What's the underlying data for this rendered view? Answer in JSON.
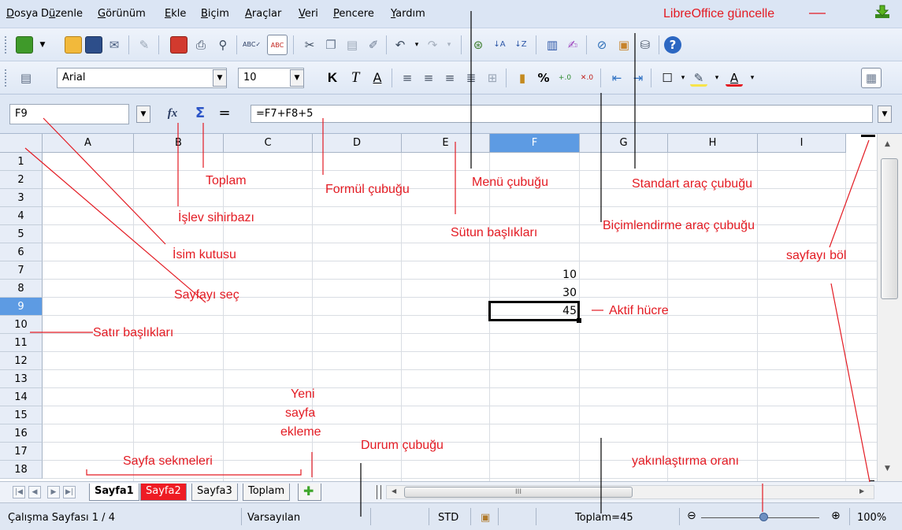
{
  "menubar": {
    "items": [
      {
        "ul": "D",
        "rest": "osya"
      },
      {
        "ul": "",
        "pre": "D",
        "ul2": "ü",
        "rest": "zenle"
      },
      {
        "ul": "G",
        "rest": "örünüm"
      },
      {
        "ul": "E",
        "rest": "kle"
      },
      {
        "ul": "B",
        "rest": "içim"
      },
      {
        "ul": "A",
        "rest": "raçlar"
      },
      {
        "ul": "V",
        "rest": "eri"
      },
      {
        "ul": "P",
        "rest": "encere"
      },
      {
        "ul": "Y",
        "rest": "ardım"
      }
    ],
    "update_text": "LibreOffice güncelle",
    "update_icon": "download-arrow-icon"
  },
  "formatting": {
    "font_name": "Arial",
    "font_size": "10",
    "bold": "K",
    "italic": "T",
    "underline": "A",
    "percent": "%"
  },
  "formula_bar": {
    "name_box_value": "F9",
    "formula_value": "=F7+F8+5",
    "wizard_glyph": "fx",
    "sum_glyph": "Σ",
    "equals_glyph": "="
  },
  "grid": {
    "columns": [
      "A",
      "B",
      "C",
      "D",
      "E",
      "F",
      "G",
      "H",
      "I"
    ],
    "active_column": "F",
    "rows": [
      "1",
      "2",
      "3",
      "4",
      "5",
      "6",
      "7",
      "8",
      "9",
      "10",
      "11",
      "12",
      "13",
      "14",
      "15",
      "16",
      "17",
      "18"
    ],
    "active_row": "9",
    "cells": {
      "F7": "10",
      "F8": "30",
      "F9": "45"
    }
  },
  "sheet_tabs": [
    "Sayfa1",
    "Sayfa2",
    "Sayfa3",
    "Toplam"
  ],
  "hscroll_thumb_label": "III",
  "statusbar": {
    "sheet_info": "Çalışma Sayfası 1 / 4",
    "page_style": "Varsayılan",
    "mode": "STD",
    "sum": "Toplam=45",
    "zoom_minus": "⊖",
    "zoom_plus": "⊕",
    "zoom": "100%"
  },
  "annotations": {
    "toplam": "Toplam",
    "formul_cubugu": "Formül çubuğu",
    "menu_cubugu": "Menü çubuğu",
    "standart_arac": "Standart araç çubuğu",
    "islev_sihirbazi": "İşlev sihirbazı",
    "sutun_basliklari": "Sütun başlıkları",
    "bicimlendirme": "Biçimlendirme araç çubuğu",
    "isim_kutusu": "İsim kutusu",
    "sayfayi_bol": "sayfayı böl",
    "sayfayi_sec": "Sayfayı seç",
    "aktif_hucre": "Aktif hücre",
    "satir_basliklari": "Satır başlıkları",
    "yeni_1": "Yeni",
    "yeni_2": "sayfa",
    "yeni_3": "ekleme",
    "durum_cubugu": "Durum çubuğu",
    "sayfa_sekmeleri": "Sayfa sekmeleri",
    "yakinlastirma": "yakınlaştırma oranı"
  },
  "colors": {
    "annotation": "#e31b23",
    "active_header": "#5d9be3",
    "active_tab": "#ee1c24"
  }
}
